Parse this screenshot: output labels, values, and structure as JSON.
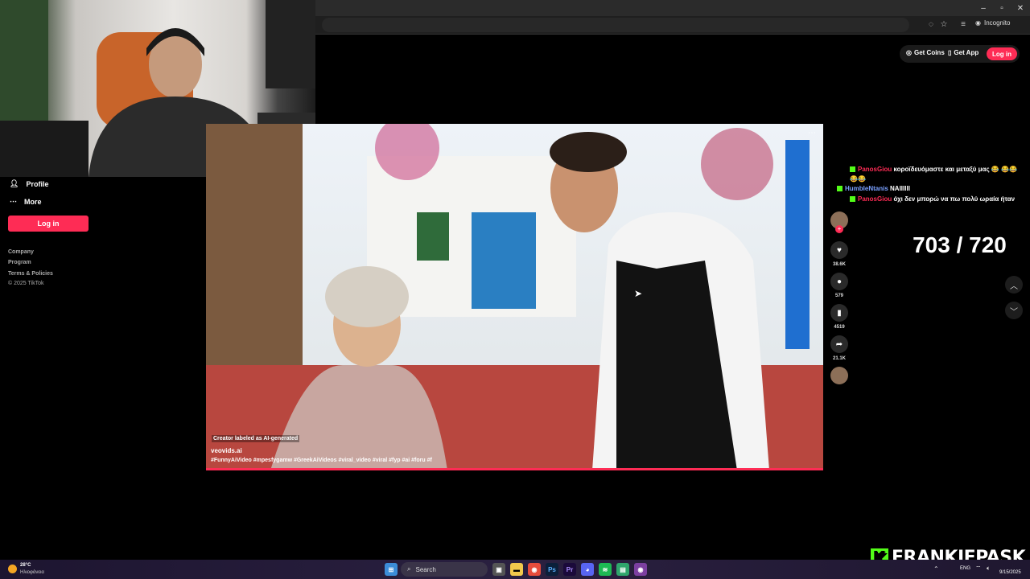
{
  "browser": {
    "mode_label": "Incognito",
    "window_controls": [
      "–",
      "▫",
      "✕"
    ]
  },
  "tiktok": {
    "header": {
      "get_coins": "Get Coins",
      "get_app": "Get App",
      "login": "Log in"
    },
    "sidebar": {
      "items": [
        {
          "label": "Profile",
          "icon": "person-icon"
        },
        {
          "label": "More",
          "icon": "more-icon"
        }
      ],
      "login": "Log in",
      "footer": [
        "Company",
        "Program",
        "Terms & Policies",
        "© 2025 TikTok"
      ]
    },
    "video": {
      "ai_label": "Creator labeled as AI-generated",
      "author": "veovids.ai",
      "hashtags": "#FunnyAiVideo #mpesfygamw #GreekAiVideos #viral_video #viral #fyp #ai #foru #f"
    },
    "actions": {
      "likes": "38.6K",
      "comments": "579",
      "saves": "4519",
      "shares": "21.1K"
    }
  },
  "stream": {
    "chat": [
      {
        "user": "PanosGiou",
        "message": "κοροϊδευόμαστε και μεταξύ μας 😂 😂😂😂😂"
      },
      {
        "user": "HumbleNtanis",
        "message": "ΝΑΙΙΙΙΙΙ"
      },
      {
        "user": "PanosGiou",
        "message": "όχι δεν μπορώ να πω πολύ ωραία ήταν"
      }
    ],
    "counter": "703 / 720",
    "brand": "FRANKIEPASK"
  },
  "taskbar": {
    "weather_temp": "28°C",
    "weather_desc": "Ηλιοφάνεια",
    "search": "Search",
    "lang": "ENG",
    "date": "9/15/2025"
  },
  "colors": {
    "accent": "#fe2c55",
    "kick_green": "#53fc18",
    "chat_user_blue": "#7aa0ff"
  }
}
